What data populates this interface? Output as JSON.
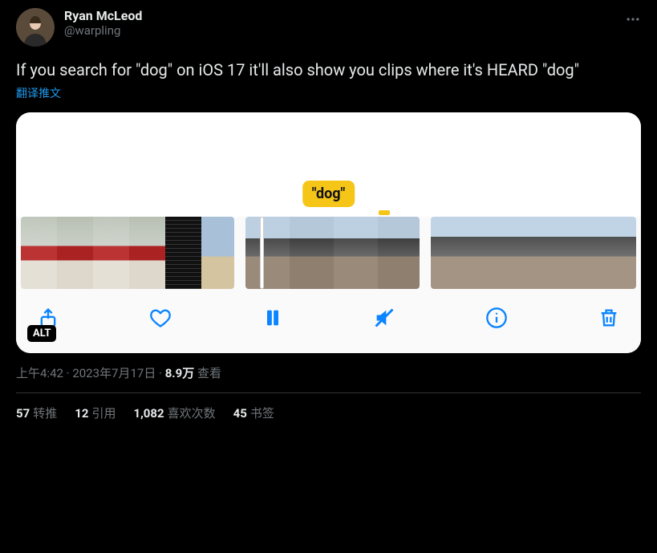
{
  "author": {
    "display_name": "Ryan McLeod",
    "handle": "@warpling"
  },
  "body": "If you search for \"dog\" on iOS 17 it'll also show you clips where it's HEARD \"dog\"",
  "translate_label": "翻译推文",
  "media": {
    "caption_bubble": "\"dog\"",
    "alt_badge": "ALT"
  },
  "meta": {
    "time": "上午4:42",
    "date": "2023年7月17日",
    "views_count": "8.9万",
    "views_label": "查看"
  },
  "stats": {
    "retweets_count": "57",
    "retweets_label": "转推",
    "quotes_count": "12",
    "quotes_label": "引用",
    "likes_count": "1,082",
    "likes_label": "喜欢次数",
    "bookmarks_count": "45",
    "bookmarks_label": "书签"
  }
}
